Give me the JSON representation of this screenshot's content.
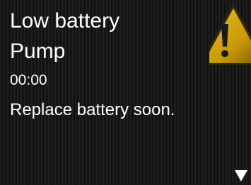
{
  "alert": {
    "title": "Low battery",
    "source": "Pump",
    "time": "00:00",
    "message": "Replace battery soon."
  },
  "icons": {
    "warning": "warning-triangle-icon",
    "scroll": "arrow-down-icon"
  },
  "colors": {
    "background": "#121212",
    "text": "#ffffff",
    "warning_fill": "#d4a90c",
    "warning_mark": "#1a1a1a"
  }
}
